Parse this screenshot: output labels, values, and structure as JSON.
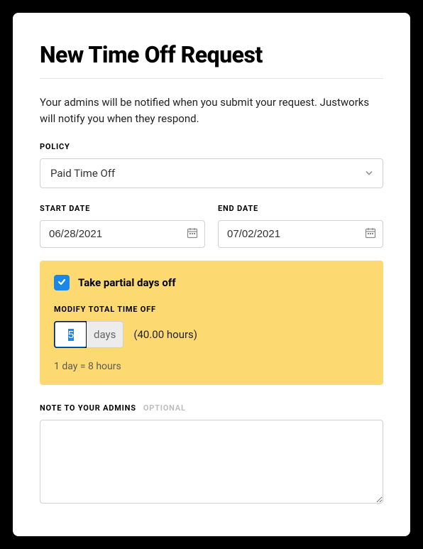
{
  "title": "New Time Off Request",
  "intro": "Your admins will be notified when you submit your request. Justworks will notify you when they respond.",
  "policy": {
    "label": "POLICY",
    "value": "Paid Time Off"
  },
  "start_date": {
    "label": "START DATE",
    "value": "06/28/2021"
  },
  "end_date": {
    "label": "END DATE",
    "value": "07/02/2021"
  },
  "partial": {
    "checkbox_label": "Take partial days off",
    "modify_label": "MODIFY TOTAL TIME OFF",
    "days_value": "5",
    "days_suffix": "days",
    "hours_text": "(40.00 hours)",
    "hint": "1 day = 8 hours"
  },
  "note": {
    "label": "NOTE TO YOUR ADMINS",
    "optional": "OPTIONAL",
    "value": ""
  }
}
